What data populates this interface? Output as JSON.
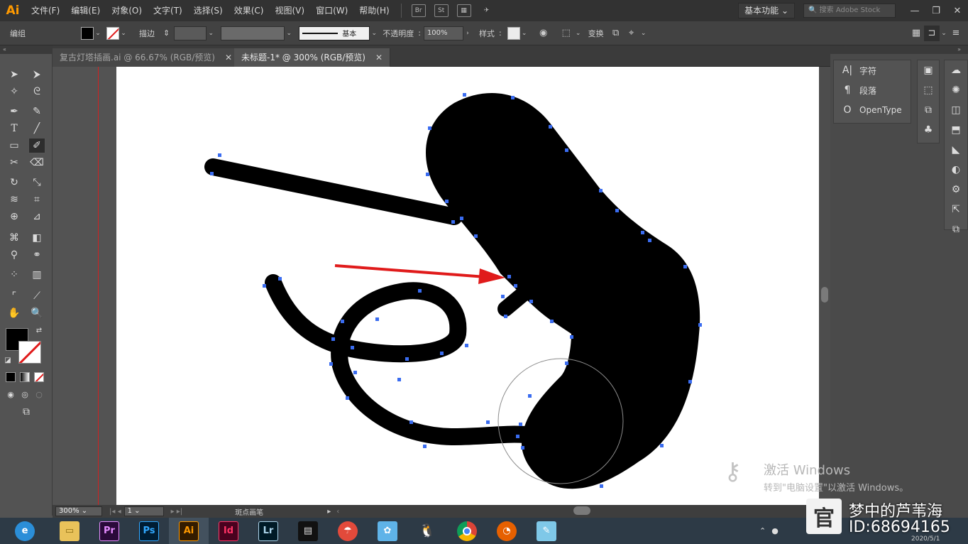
{
  "app": {
    "logo": "Ai",
    "menu": [
      "文件(F)",
      "编辑(E)",
      "对象(O)",
      "文字(T)",
      "选择(S)",
      "效果(C)",
      "视图(V)",
      "窗口(W)",
      "帮助(H)"
    ],
    "bridge_label": "Br",
    "stock_label": "St",
    "workspace": "基本功能",
    "search_placeholder": "搜索 Adobe Stock"
  },
  "control_bar": {
    "selection_label": "编组",
    "stroke_label": "描边",
    "stroke_style": "基本",
    "opacity_label": "不透明度",
    "opacity_value": "100%",
    "style_label": "样式",
    "transform_label": "变换"
  },
  "tabs": [
    {
      "label": "复古灯塔插画.ai @ 66.67% (RGB/预览)",
      "active": false
    },
    {
      "label": "未标题-1* @ 300% (RGB/预览)",
      "active": true
    }
  ],
  "status": {
    "zoom": "300%",
    "artboard": "1",
    "tool_name": "斑点画笔"
  },
  "right_panel": {
    "items": [
      {
        "icon": "character-icon",
        "label": "字符"
      },
      {
        "icon": "paragraph-icon",
        "label": "段落"
      },
      {
        "icon": "opentype-icon",
        "label": "OpenType"
      }
    ]
  },
  "watermark": {
    "title": "激活 Windows",
    "subtitle": "转到\"电脑设置\"以激活 Windows。"
  },
  "taskbar": {
    "apps": [
      "Pr",
      "Ps",
      "Ai",
      "Id",
      "Lr"
    ],
    "date": "2020/5/1"
  },
  "brand": {
    "name": "梦中的芦苇海",
    "id": "ID:68694165"
  },
  "colors": {
    "accent_arrow": "#e01b1b",
    "anchor": "#3a6cf0",
    "guide": "#d12020"
  }
}
